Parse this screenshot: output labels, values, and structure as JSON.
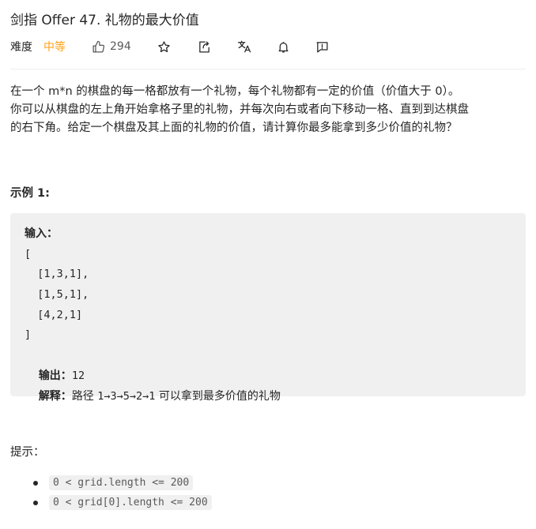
{
  "problem": {
    "title": "剑指 Offer 47. 礼物的最大价值",
    "difficulty_label": "难度",
    "difficulty": "中等",
    "likes": "294"
  },
  "description": [
    "在一个 m*n 的棋盘的每一格都放有一个礼物，每个礼物都有一定的价值（价值大于 0）。",
    "你可以从棋盘的左上角开始拿格子里的礼物，并每次向右或者向下移动一格、直到到达棋盘",
    "的右下角。给定一个棋盘及其上面的礼物的价值，请计算你最多能拿到多少价值的礼物？"
  ],
  "example": {
    "title": "示例 1:",
    "input_label": "输入：",
    "input_lines": [
      "[",
      "  [1,3,1],",
      "  [1,5,1],",
      "  [4,2,1]",
      "]"
    ],
    "output_label": "输出：",
    "output_value": "12",
    "explain_label": "解释：",
    "explain_path": "路径 ",
    "explain_path_value": "1→3→5→2→1",
    "explain_text": " 可以拿到最多价值的礼物"
  },
  "hints": {
    "title": "提示：",
    "constraints": [
      "0 < grid.length <= 200",
      "0 < grid[0].length <= 200"
    ]
  },
  "colors": {
    "difficulty_medium": "#ffa116",
    "code_background": "#f0f0f0"
  },
  "icons": [
    "thumbs-up-icon",
    "star-icon",
    "share-icon",
    "translate-icon",
    "bell-icon",
    "feedback-icon"
  ]
}
